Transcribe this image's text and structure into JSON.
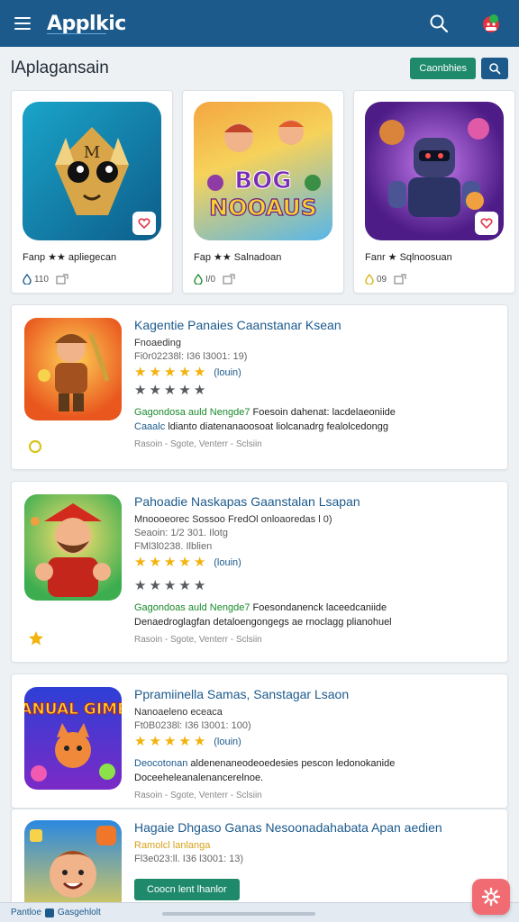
{
  "header": {
    "logo": "Applkic",
    "icons": {
      "menu": "menu-icon",
      "search": "search-icon",
      "avatar": "avatar-icon"
    }
  },
  "section": {
    "title": "lAplagansain",
    "action_label": "Caonbhies"
  },
  "grid_cards": [
    {
      "label": "Fanp ★★ apliegecan",
      "stat": "110",
      "icon_color": "#1c5a8c"
    },
    {
      "label": "Fap ★★ Salnadoan",
      "stat": "I/0",
      "icon_color": "#1a8a2a"
    },
    {
      "label": "Fanr ★ Sqlnoosuan",
      "stat": "09",
      "icon_color": "#d4b312"
    }
  ],
  "list_cards": [
    {
      "title": "Kagentie Panaies Caanstanar Ksean",
      "subtitle": "Fnoaeding",
      "date": "Fi0r02238l: I36 l3001: 19)",
      "link": "(louin)",
      "desc_lead": "Gagondosa auld Nengde7",
      "desc_rest": "Foesoin dahenat: lacdelaeoniide",
      "desc2_lead": "Caaalc",
      "desc2_rest": "ldianto diatenanaoosoat liolcanadrg fealolcedongg",
      "footer": "Rasoin - Sgote, Venterr - Sclsiin"
    },
    {
      "title": "Pahoadie Naskapas Gaanstalan Lsapan",
      "subtitle": "Mnoooeorec Sossoo FredOl onloaoredas l 0)",
      "date": "Seaoin: 1/2 301. Ilotg",
      "date2": "FMl3l0238. Ilblien",
      "link": "(louin)",
      "desc_lead": "Gagondoas auld Nengde7",
      "desc_rest": "Foesondanenck laceedcaniide",
      "desc3": "Denaedroglagfan detaloengongegs ae rnoclagg plianohuel",
      "footer": "Rasoin - Sgote, Venterr - Sclsiin"
    },
    {
      "title": "Ppramiinella Samas, Sanstagar Lsaon",
      "subtitle": "Nanoaeleno eceaca",
      "date": "Ft0B0238l: I36 l3001: 100)",
      "link": "(louin)",
      "desc_lead": "Deocotonan",
      "desc_rest": "aldenenaneodeoedesies pescon ledonokanide",
      "desc3": "Doceeheleanalenancerelnoe.",
      "footer": "Rasoin - Sgote, Venterr - Sclsiin",
      "thumb_text": "NANUAL GIMES"
    },
    {
      "title": "Hagaie Dhgaso Ganas Nesoonadahabata Apan aedien",
      "subtitle": "Ramolcl lanlanga",
      "date": "Fl3e023:ll. I36 l3001: 13)",
      "button": "Coocn lent lhanlor"
    }
  ],
  "bottom_bar": {
    "left": "Pantloe",
    "right": "Gasgehlolt"
  },
  "colors": {
    "primary": "#1c5a8c",
    "accent_green": "#1f8a6b",
    "star": "#f3b20c",
    "fab": "#f06b72"
  }
}
